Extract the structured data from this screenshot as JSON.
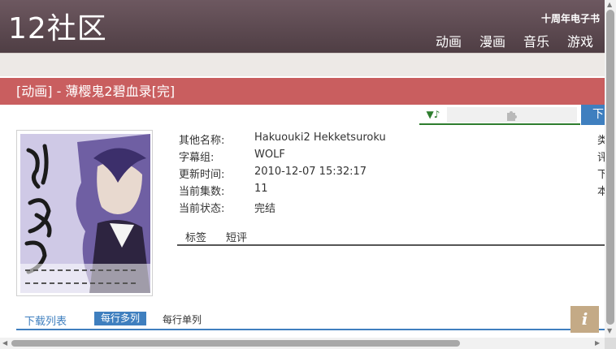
{
  "header": {
    "logo": "12社区",
    "slogan": "十周年电子书",
    "nav": [
      "动画",
      "漫画",
      "音乐",
      "游戏"
    ]
  },
  "title": "[动画] - 薄樱鬼2碧血录[完]",
  "toolbar": {
    "music_icon": "music-note-icon",
    "plugin_icon": "puzzle-icon",
    "download_label": "下"
  },
  "details": [
    {
      "label": "其他名称:",
      "value": "Hakuouki2 Hekketsuroku"
    },
    {
      "label": "字幕组:",
      "value": "WOLF"
    },
    {
      "label": "更新时间:",
      "value": "2010-12-07 15:32:17"
    },
    {
      "label": "当前集数:",
      "value": "11"
    },
    {
      "label": "当前状态:",
      "value": "完结"
    }
  ],
  "right_labels": [
    "类",
    "评",
    "下",
    "本"
  ],
  "tabs": [
    "标签",
    "短评"
  ],
  "list": {
    "title": "下载列表",
    "modes": [
      "每行多列",
      "每行单列"
    ]
  },
  "colors": {
    "header_bg": "#5d4a51",
    "title_bar": "#c95e5f",
    "accent_blue": "#3f7fbf",
    "accent_green": "#2e7d2e"
  }
}
